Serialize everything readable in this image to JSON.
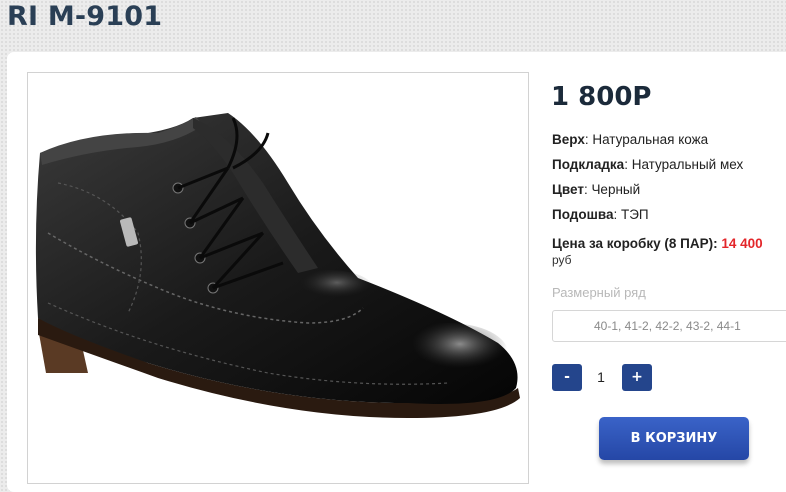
{
  "product": {
    "title": "RI M-9101",
    "price": "1 800Р",
    "specs": [
      {
        "label": "Верх",
        "value": ": Натуральная кожа"
      },
      {
        "label": "Подкладка",
        "value": ": Натуральный мех"
      },
      {
        "label": "Цвет",
        "value": ": Черный"
      },
      {
        "label": "Подошва",
        "value": ": ТЭП"
      }
    ],
    "box_price": {
      "label": "Цена за коробку (8 ПАР):",
      "value": "14 400",
      "unit": "руб"
    }
  },
  "sizes": {
    "label": "Размерный ряд",
    "selected": "40-1, 41-2, 42-2, 43-2, 44-1"
  },
  "quantity": {
    "minus": "-",
    "value": "1",
    "plus": "+"
  },
  "cart_button": "В КОРЗИНУ",
  "colors": {
    "accent": "#24458c",
    "price_red": "#e3262a",
    "title": "#2a3f55"
  },
  "image": {
    "icon": "boot-product-photo"
  }
}
